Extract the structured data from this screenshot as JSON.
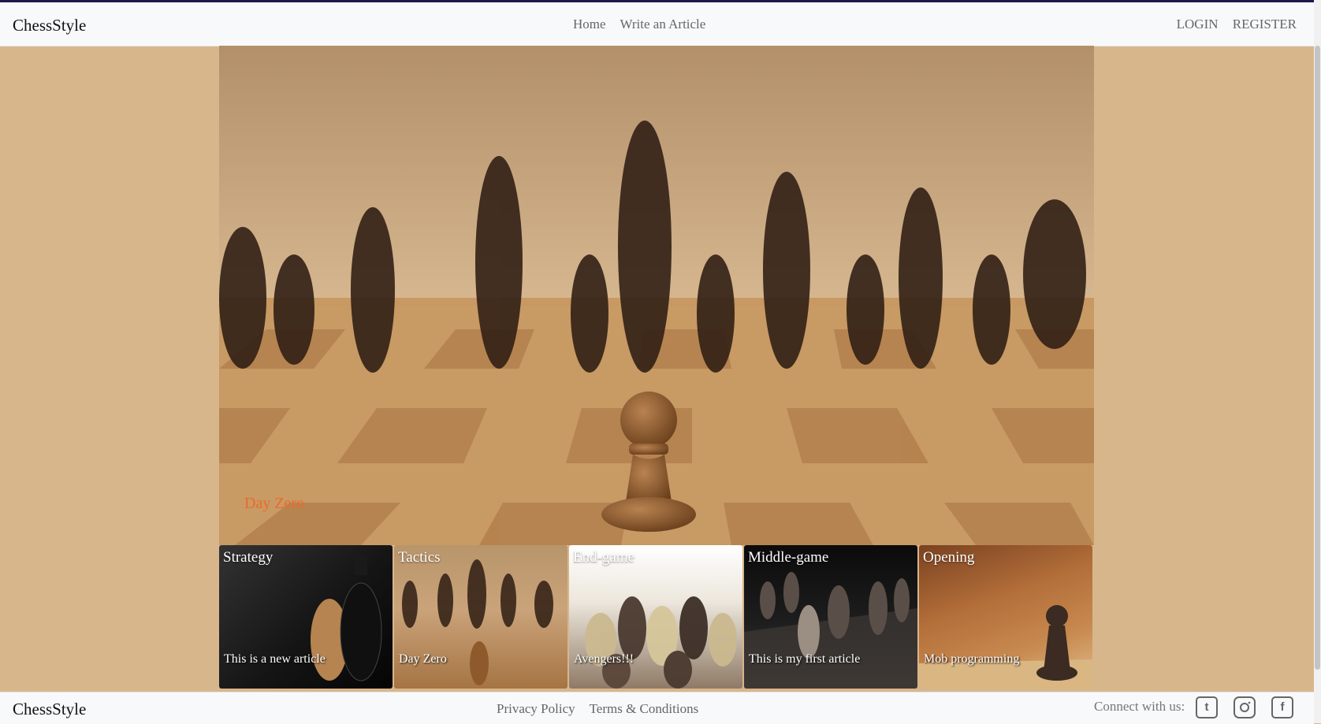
{
  "header": {
    "brand": "ChessStyle",
    "nav": [
      "Home",
      "Write an Article"
    ],
    "auth": [
      "LOGIN",
      "REGISTER"
    ]
  },
  "hero": {
    "caption": "Day Zero"
  },
  "cards": [
    {
      "category": "Strategy",
      "title": "This is a new article"
    },
    {
      "category": "Tactics",
      "title": "Day Zero"
    },
    {
      "category": "End-game",
      "title": "Avengers!!!"
    },
    {
      "category": "Middle-game",
      "title": "This is my first article"
    },
    {
      "category": "Opening",
      "title": "Mob programming"
    }
  ],
  "footer": {
    "brand": "ChessStyle",
    "links": [
      "Privacy Policy",
      "Terms & Conditions"
    ],
    "connect": "Connect with us:",
    "social": [
      "twitter-icon",
      "instagram-icon",
      "facebook-icon"
    ]
  },
  "colors": {
    "background": "#d8b68c",
    "caption": "#ec6a2a",
    "navbar": "#f8f9fb"
  }
}
